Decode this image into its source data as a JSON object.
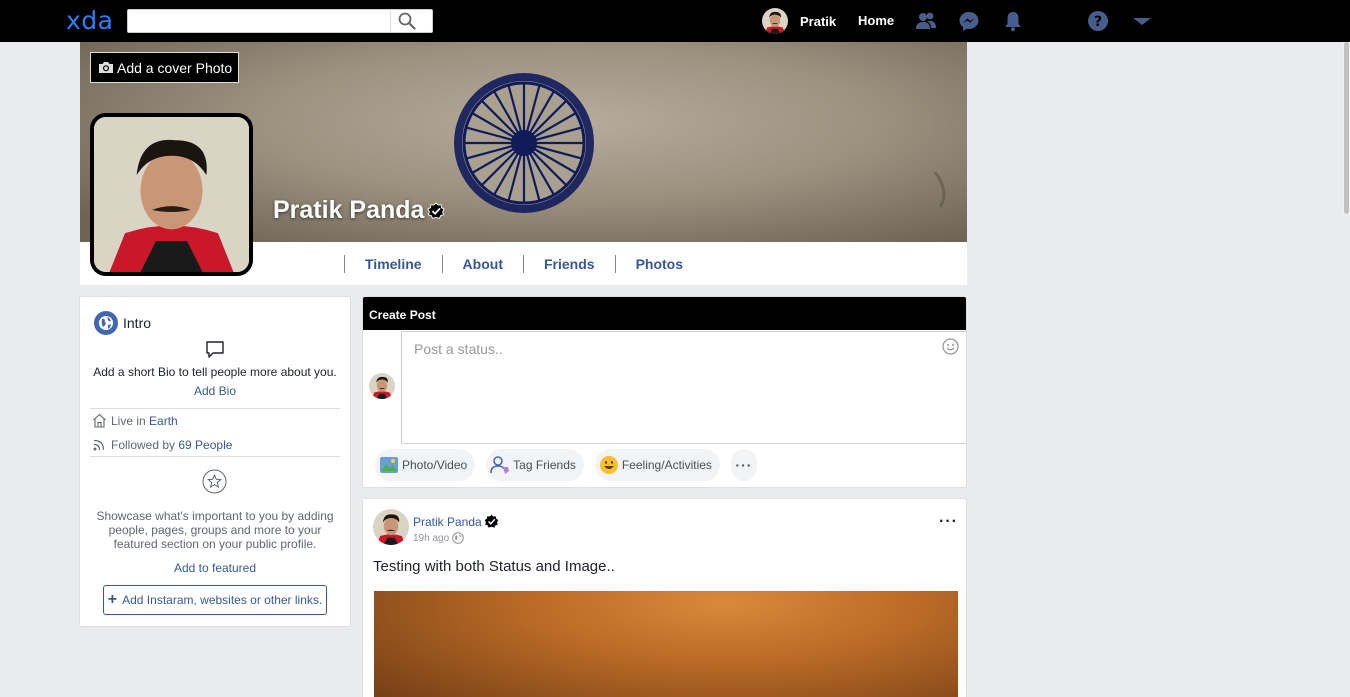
{
  "topbar": {
    "logo": "xda",
    "search_placeholder": "",
    "user_name": "Pratik",
    "home_label": "Home",
    "icons": [
      "friends-icon",
      "messenger-icon",
      "notifications-icon",
      "help-icon",
      "dropdown-icon"
    ]
  },
  "profile": {
    "add_cover_label": "Add a cover Photo",
    "name": "Pratik Panda",
    "tabs": [
      "Timeline",
      "About",
      "Friends",
      "Photos"
    ]
  },
  "intro": {
    "title": "Intro",
    "bio_prompt": "Add a short Bio to tell people more about you.",
    "add_bio": "Add Bio",
    "live_prefix": "Live in",
    "live_place": "Earth",
    "followed_prefix": "Followed by",
    "followed_count": "69 People",
    "featured_text": "Showcase what's important to you by adding people, pages, groups and more to your featured section on your public profile.",
    "add_featured": "Add to featured",
    "add_links": "Add Instaram, websites or other links."
  },
  "create_post": {
    "header": "Create Post",
    "placeholder": "Post a status..",
    "actions": {
      "photo_video": "Photo/Video",
      "tag_friends": "Tag Friends",
      "feeling": "Feeling/Activities",
      "more": "···"
    }
  },
  "post": {
    "author": "Pratik Panda",
    "time": "19h ago",
    "text": "Testing with both Status and Image..",
    "menu": "···"
  },
  "colors": {
    "topbar": "#000000",
    "link": "#365899",
    "page_bg": "#e9ebee",
    "logo": "#2d7ff9"
  }
}
